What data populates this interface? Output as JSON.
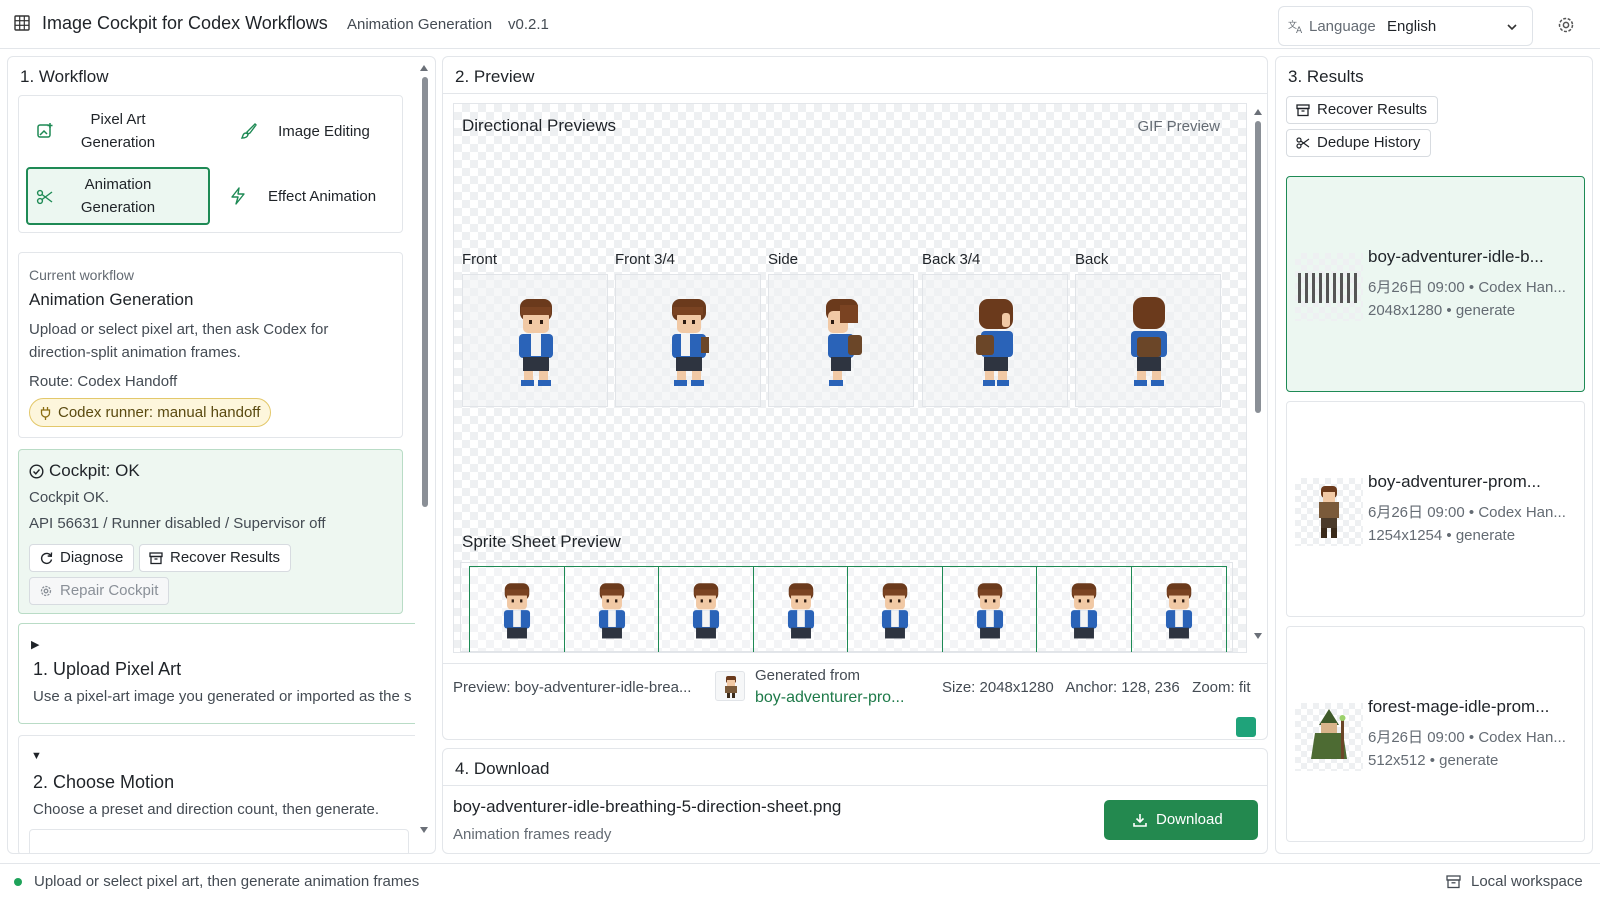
{
  "header": {
    "title": "Image Cockpit for Codex Workflows",
    "subtitle": "Animation Generation",
    "version": "v0.2.1",
    "language_label": "Language",
    "language_value": "English"
  },
  "workflow": {
    "panel_title": "1. Workflow",
    "modes": [
      {
        "label": "Pixel Art Generation",
        "icon": "image-plus-icon",
        "active": false
      },
      {
        "label": "Image Editing",
        "icon": "brush-icon",
        "active": false
      },
      {
        "label": "Animation Generation",
        "icon": "scissors-icon",
        "active": true
      },
      {
        "label": "Effect Animation",
        "icon": "lightning-icon",
        "active": false
      }
    ],
    "current_label": "Current workflow",
    "current_title": "Animation Generation",
    "current_desc": "Upload or select pixel art, then ask Codex for direction-split animation frames.",
    "route": "Route: Codex Handoff",
    "runner_badge": "Codex runner: manual handoff",
    "cockpit_title": "Cockpit: OK",
    "cockpit_sub": "Cockpit OK.",
    "cockpit_api": "API 56631 / Runner disabled / Supervisor off",
    "diagnose_label": "Diagnose",
    "recover_label": "Recover Results",
    "repair_label": "Repair Cockpit",
    "step1_title": "1. Upload Pixel Art",
    "step1_desc": "Use a pixel-art image you generated or imported as the s",
    "step2_title": "2. Choose Motion",
    "step2_desc": "Choose a preset and direction count, then generate."
  },
  "preview": {
    "panel_title": "2. Preview",
    "directional_title": "Directional Previews",
    "gif_label": "GIF Preview",
    "directions": [
      "Front",
      "Front 3/4",
      "Side",
      "Back 3/4",
      "Back"
    ],
    "sheet_title": "Sprite Sheet Preview",
    "sheet_frames": 8,
    "preview_name": "Preview: boy-adventurer-idle-brea...",
    "generated_from_label": "Generated from",
    "generated_from_link": "boy-adventurer-pro...",
    "meta": "Size: 2048x1280   Anchor: 128, 236   Zoom: fit",
    "swatch_color": "#1fa37a"
  },
  "download": {
    "panel_title": "4. Download",
    "file_name": "boy-adventurer-idle-breathing-5-direction-sheet.png",
    "status": "Animation frames ready",
    "button_label": "Download"
  },
  "results": {
    "panel_title": "3. Results",
    "recover_label": "Recover Results",
    "dedupe_label": "Dedupe History",
    "items": [
      {
        "name": "boy-adventurer-idle-b...",
        "time": "6月26日 09:00 • Codex Han...",
        "size": "2048x1280 • generate",
        "active": true
      },
      {
        "name": "boy-adventurer-prom...",
        "time": "6月26日 09:00 • Codex Han...",
        "size": "1254x1254 • generate",
        "active": false
      },
      {
        "name": "forest-mage-idle-prom...",
        "time": "6月26日 09:00 • Codex Han...",
        "size": "512x512 • generate",
        "active": false
      }
    ]
  },
  "status_bar": {
    "message": "Upload or select pixel art, then generate animation frames",
    "workspace": "Local workspace"
  },
  "colors": {
    "accent": "#1e8a55",
    "download_button": "#23894f",
    "badge_bg": "#fdf6dc"
  }
}
